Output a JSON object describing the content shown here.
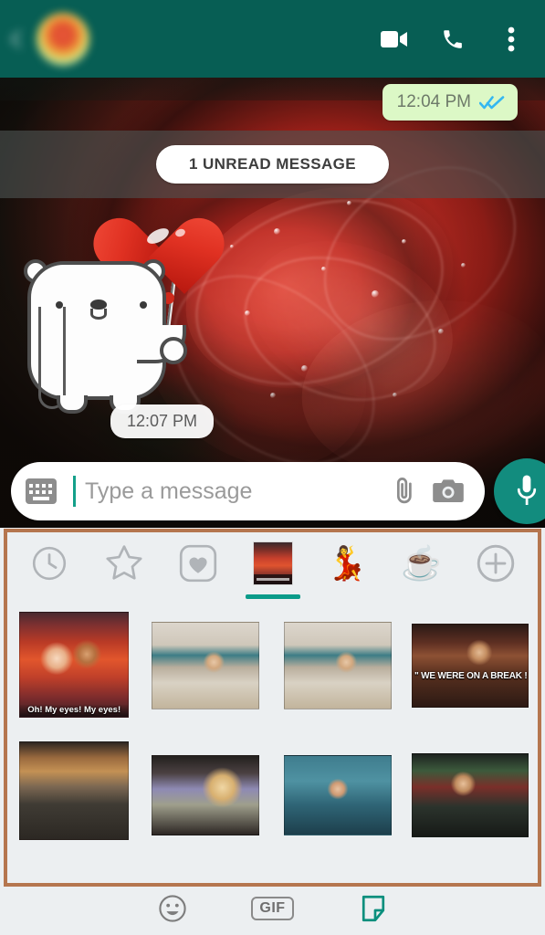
{
  "header": {
    "back_icon": "back-arrow-icon",
    "avatar": "contact-avatar",
    "contact_name": "",
    "contact_status": "",
    "video_call_icon": "video-call-icon",
    "voice_call_icon": "phone-call-icon",
    "overflow_icon": "more-options-icon",
    "bg_color": "#075E54"
  },
  "chat": {
    "outgoing_message": {
      "time": "12:04 PM",
      "read_receipt": "double-blue-check",
      "receipt_color": "#34B7F1",
      "bubble_color": "#DCF8C6"
    },
    "unread_divider": {
      "label": "1 UNREAD MESSAGE"
    },
    "sticker_message": {
      "sticker_name": "white-bear-with-heart-balloon",
      "time": "12:07 PM"
    },
    "wallpaper": "red-rose-macro"
  },
  "input_bar": {
    "keyboard_icon": "keyboard-icon",
    "placeholder": "Type a message",
    "value": "",
    "attach_icon": "paperclip-icon",
    "camera_icon": "camera-icon",
    "mic_icon": "microphone-icon",
    "mic_color": "#128C7E"
  },
  "sticker_panel": {
    "frame_color": "#B5764F",
    "active_underline_color": "#0A9B89",
    "tabs": [
      {
        "id": "recents",
        "icon": "clock-icon",
        "label": "Recents",
        "active": false
      },
      {
        "id": "starred",
        "icon": "star-icon",
        "label": "Starred",
        "active": false
      },
      {
        "id": "favorites",
        "icon": "heart-icon",
        "label": "Favorites",
        "active": false
      },
      {
        "id": "friends-pack",
        "icon": "friends-sticker-pack-thumb",
        "label": "Friends",
        "active": true
      },
      {
        "id": "party-pack",
        "icon": "party-people-icon",
        "label": "Party",
        "active": false
      },
      {
        "id": "coffee-pack",
        "icon": "coffee-cup-icon",
        "label": "Coffee",
        "active": false
      },
      {
        "id": "add-pack",
        "icon": "plus-circle-icon",
        "label": "Add stickers",
        "active": false
      }
    ],
    "stickers": [
      {
        "id": "s1",
        "name": "phoebe-oh-my-eyes",
        "caption": "Oh! My eyes! My eyes!"
      },
      {
        "id": "s2",
        "name": "joey-rubbing-hands",
        "caption": ""
      },
      {
        "id": "s3",
        "name": "joey-rubbing-hands-2",
        "caption": ""
      },
      {
        "id": "s4",
        "name": "ross-we-were-on-a-break",
        "caption": "\" WE WERE ON A BREAK ! \""
      },
      {
        "id": "s5",
        "name": "phoebe-under-table",
        "caption": ""
      },
      {
        "id": "s6",
        "name": "monica-turkey-head",
        "caption": ""
      },
      {
        "id": "s7",
        "name": "ross-hands-up",
        "caption": ""
      },
      {
        "id": "s8",
        "name": "chandler-leather-jacket",
        "caption": ""
      }
    ]
  },
  "bottom_bar": {
    "items": [
      {
        "id": "emoji",
        "icon": "smiley-icon",
        "label": "Emoji",
        "active": false
      },
      {
        "id": "gif",
        "icon": "gif-icon",
        "label": "GIF",
        "active": false
      },
      {
        "id": "sticker",
        "icon": "sticker-icon",
        "label": "Sticker",
        "active": true
      }
    ],
    "active_color": "#0A8F7D"
  }
}
